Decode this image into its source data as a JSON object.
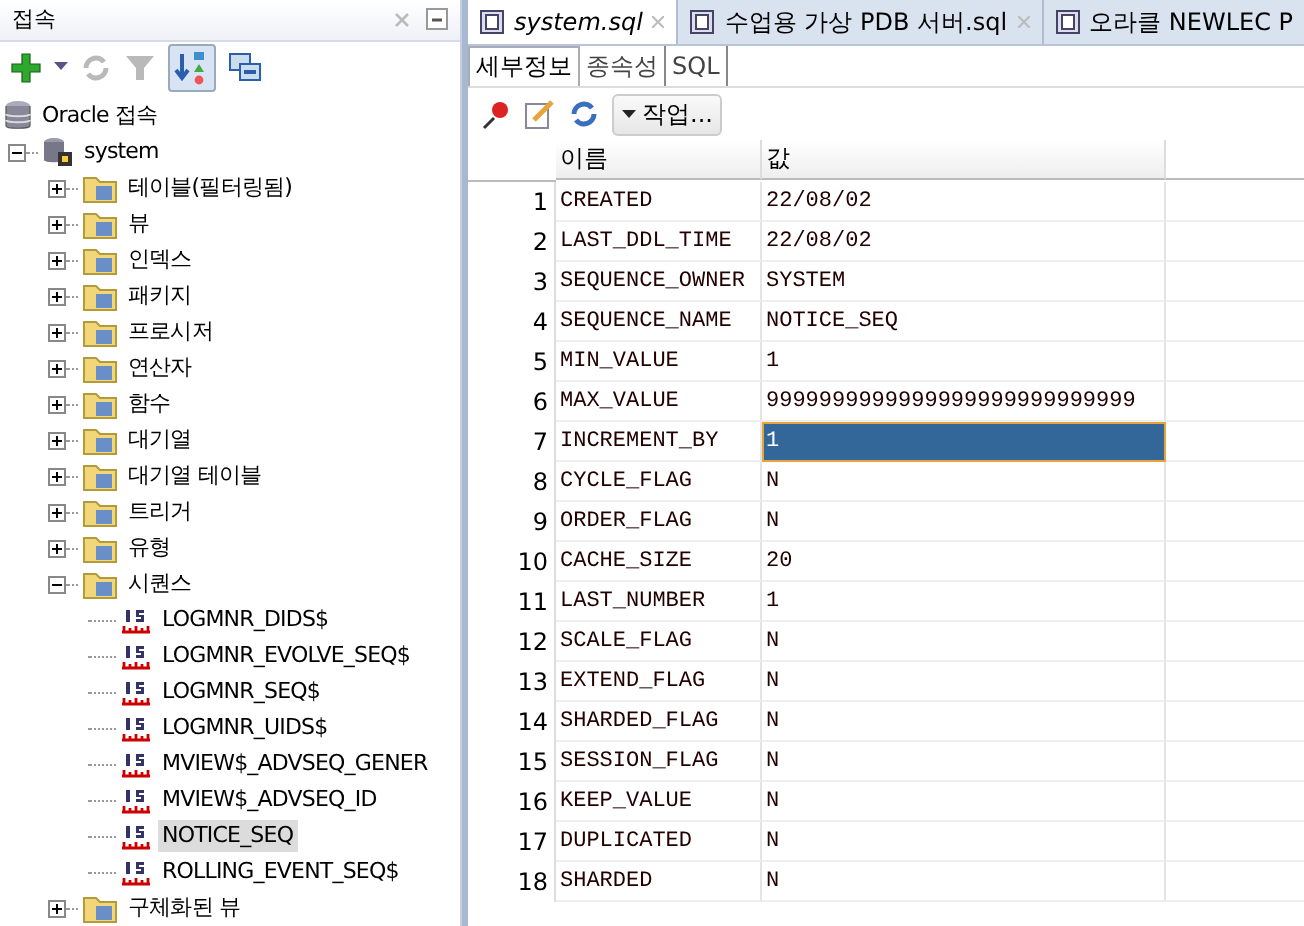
{
  "connections_panel": {
    "title": "접속",
    "toolbar": [
      {
        "kind": "add",
        "disabled": false
      },
      {
        "kind": "caret",
        "disabled": false
      },
      {
        "kind": "refresh",
        "disabled": true
      },
      {
        "kind": "filter",
        "disabled": true
      },
      {
        "kind": "sort",
        "disabled": false
      },
      {
        "kind": "schema",
        "disabled": false
      }
    ],
    "tree": [
      {
        "label": "Oracle 접속",
        "kind": "root",
        "children": [
          {
            "label": "system",
            "kind": "connection",
            "expanded": true,
            "children": [
              {
                "label": "테이블(필터링됨)",
                "kind": "folder",
                "expanded": false
              },
              {
                "label": "뷰",
                "kind": "folder",
                "expanded": false
              },
              {
                "label": "인덱스",
                "kind": "folder",
                "expanded": false
              },
              {
                "label": "패키지",
                "kind": "folder",
                "expanded": false
              },
              {
                "label": "프로시저",
                "kind": "folder",
                "expanded": false
              },
              {
                "label": "연산자",
                "kind": "folder",
                "expanded": false
              },
              {
                "label": "함수",
                "kind": "folder",
                "expanded": false
              },
              {
                "label": "대기열",
                "kind": "folder",
                "expanded": false
              },
              {
                "label": "대기열 테이블",
                "kind": "folder",
                "expanded": false
              },
              {
                "label": "트리거",
                "kind": "folder",
                "expanded": false
              },
              {
                "label": "유형",
                "kind": "folder",
                "expanded": false
              },
              {
                "label": "시퀀스",
                "kind": "folder",
                "expanded": true,
                "children": [
                  {
                    "label": "LOGMNR_DIDS$",
                    "kind": "sequence",
                    "selected": false
                  },
                  {
                    "label": "LOGMNR_EVOLVE_SEQ$",
                    "kind": "sequence",
                    "selected": false
                  },
                  {
                    "label": "LOGMNR_SEQ$",
                    "kind": "sequence",
                    "selected": false
                  },
                  {
                    "label": "LOGMNR_UIDS$",
                    "kind": "sequence",
                    "selected": false
                  },
                  {
                    "label": "MVIEW$_ADVSEQ_GENER",
                    "kind": "sequence",
                    "selected": false
                  },
                  {
                    "label": "MVIEW$_ADVSEQ_ID",
                    "kind": "sequence",
                    "selected": false
                  },
                  {
                    "label": "NOTICE_SEQ",
                    "kind": "sequence",
                    "selected": true
                  },
                  {
                    "label": "ROLLING_EVENT_SEQ$",
                    "kind": "sequence",
                    "selected": false
                  }
                ]
              },
              {
                "label": "구체화된 뷰",
                "kind": "folder",
                "expanded": false
              }
            ]
          }
        ]
      }
    ]
  },
  "editor_tabs": [
    {
      "label": "system.sql",
      "selected": true
    },
    {
      "label": "수업용 가상 PDB 서버.sql",
      "selected": false
    },
    {
      "label": "오라클 NEWLEC P",
      "selected": false
    }
  ],
  "sub_tabs": [
    {
      "label": "세부정보",
      "selected": true
    },
    {
      "label": "종속성",
      "selected": false
    },
    {
      "label": "SQL",
      "selected": false
    }
  ],
  "actions_button": "작업...",
  "table": {
    "columns": [
      "이름",
      "값"
    ],
    "rows": [
      {
        "num": "1",
        "name": "CREATED",
        "value": "22/08/02",
        "selected": false
      },
      {
        "num": "2",
        "name": "LAST_DDL_TIME",
        "value": "22/08/02",
        "selected": false
      },
      {
        "num": "3",
        "name": "SEQUENCE_OWNER",
        "value": "SYSTEM",
        "selected": false
      },
      {
        "num": "4",
        "name": "SEQUENCE_NAME",
        "value": "NOTICE_SEQ",
        "selected": false
      },
      {
        "num": "5",
        "name": "MIN_VALUE",
        "value": "1",
        "selected": false
      },
      {
        "num": "6",
        "name": "MAX_VALUE",
        "value": "9999999999999999999999999999",
        "selected": false
      },
      {
        "num": "7",
        "name": "INCREMENT_BY",
        "value": "1",
        "selected": true
      },
      {
        "num": "8",
        "name": "CYCLE_FLAG",
        "value": "N",
        "selected": false
      },
      {
        "num": "9",
        "name": "ORDER_FLAG",
        "value": "N",
        "selected": false
      },
      {
        "num": "10",
        "name": "CACHE_SIZE",
        "value": "20",
        "selected": false
      },
      {
        "num": "11",
        "name": "LAST_NUMBER",
        "value": "1",
        "selected": false
      },
      {
        "num": "12",
        "name": "SCALE_FLAG",
        "value": "N",
        "selected": false
      },
      {
        "num": "13",
        "name": "EXTEND_FLAG",
        "value": "N",
        "selected": false
      },
      {
        "num": "14",
        "name": "SHARDED_FLAG",
        "value": "N",
        "selected": false
      },
      {
        "num": "15",
        "name": "SESSION_FLAG",
        "value": "N",
        "selected": false
      },
      {
        "num": "16",
        "name": "KEEP_VALUE",
        "value": "N",
        "selected": false
      },
      {
        "num": "17",
        "name": "DUPLICATED",
        "value": "N",
        "selected": false
      },
      {
        "num": "18",
        "name": "SHARDED",
        "value": "N",
        "selected": false
      }
    ]
  }
}
